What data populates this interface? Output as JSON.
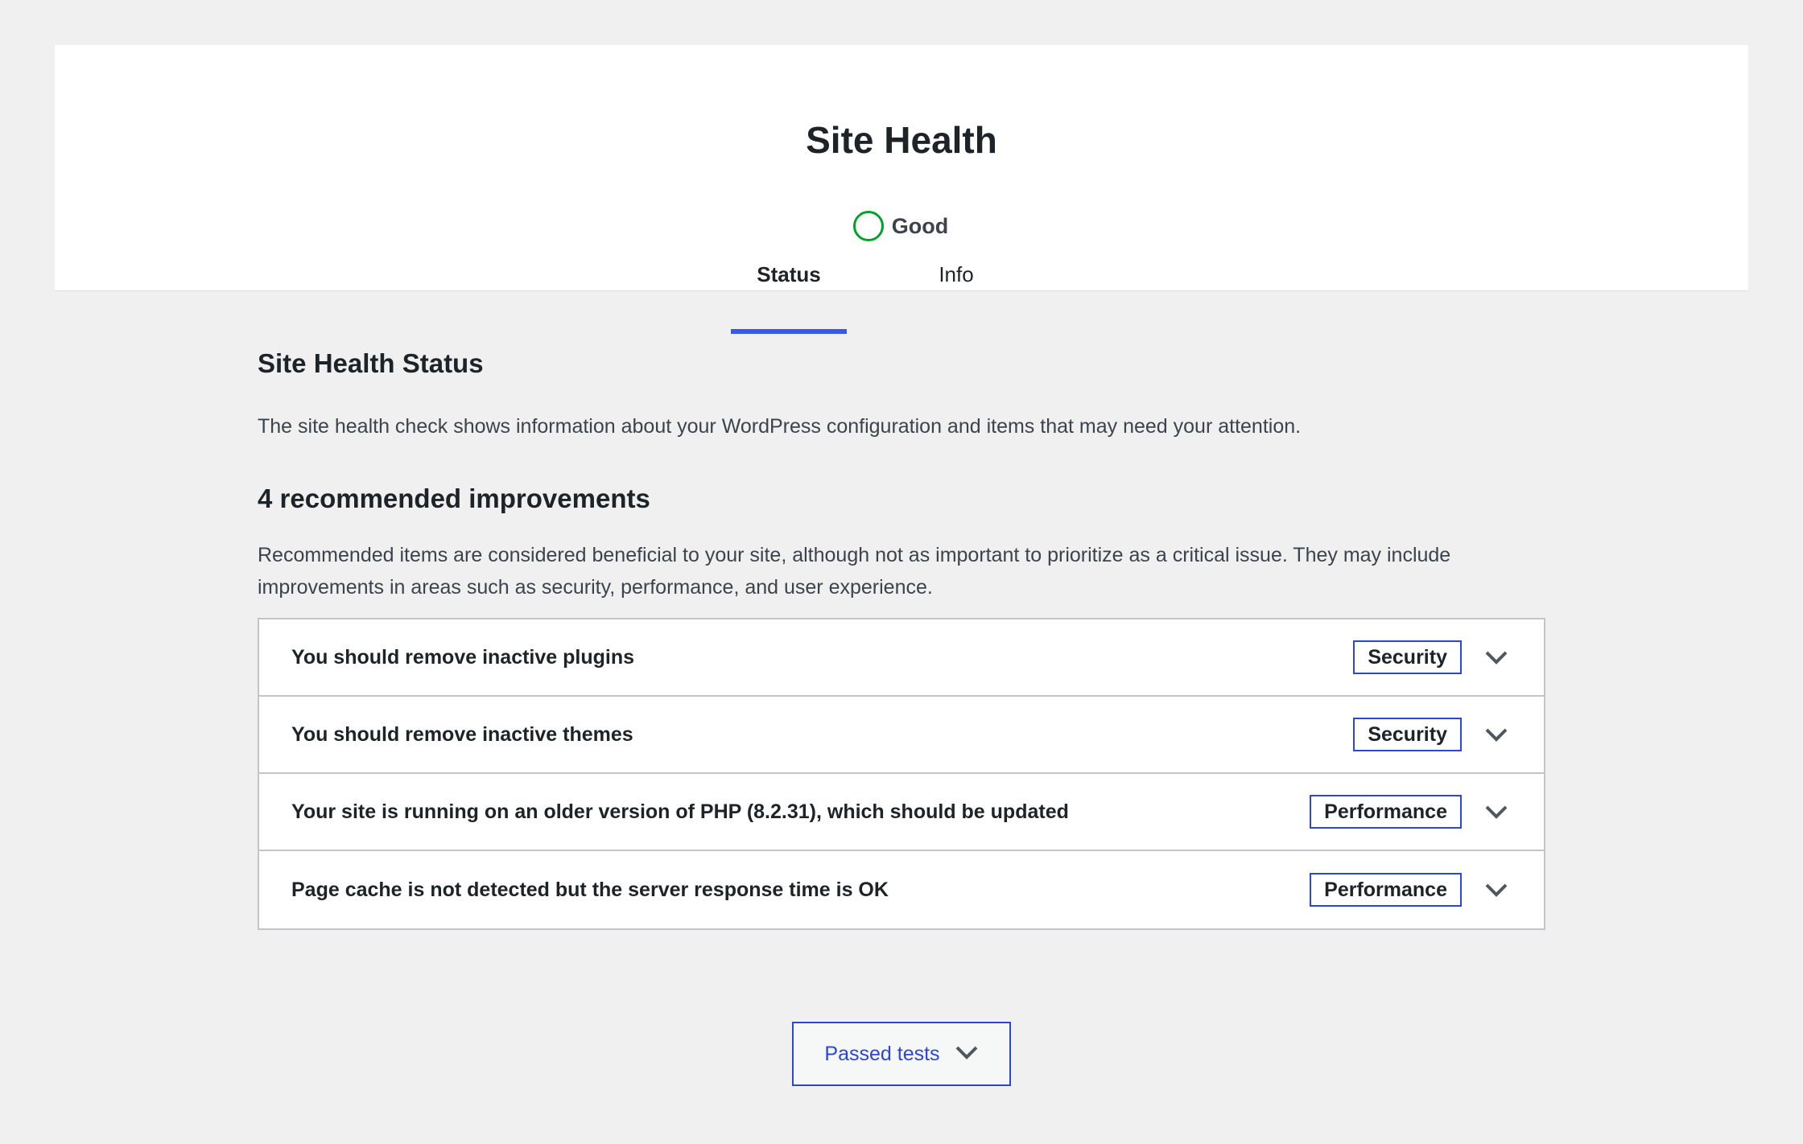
{
  "header": {
    "title": "Site Health",
    "status_label": "Good",
    "status_color": "#00a32a",
    "tabs": [
      {
        "label": "Status",
        "active": true
      },
      {
        "label": "Info",
        "active": false
      }
    ]
  },
  "main": {
    "section_title": "Site Health Status",
    "section_description": "The site health check shows information about your WordPress configuration and items that may need your attention.",
    "improvements_title": "4 recommended improvements",
    "improvements_description": "Recommended items are considered beneficial to your site, although not as important to prioritize as a critical issue. They may include improvements in areas such as security, performance, and user experience.",
    "items": [
      {
        "title": "You should remove inactive plugins",
        "badge": "Security",
        "icon": "chevron-down-icon"
      },
      {
        "title": "You should remove inactive themes",
        "badge": "Security",
        "icon": "chevron-down-icon"
      },
      {
        "title": "Your site is running on an older version of PHP (8.2.31), which should be updated",
        "badge": "Performance",
        "icon": "chevron-down-icon"
      },
      {
        "title": "Page cache is not detected but the server response time is OK",
        "badge": "Performance",
        "icon": "chevron-down-icon"
      }
    ],
    "passed_tests_label": "Passed tests"
  },
  "colors": {
    "accent": "#3858e9",
    "badge_border": "#2c47d6",
    "good": "#00a32a",
    "background": "#f0f0f1"
  }
}
